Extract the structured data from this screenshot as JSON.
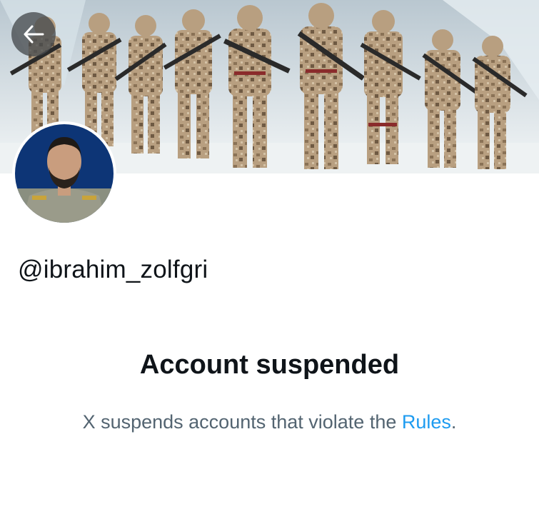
{
  "profile": {
    "handle": "@ibrahim_zolfgri"
  },
  "suspension": {
    "title": "Account suspended",
    "message_prefix": "X suspends accounts that violate the ",
    "rules_link": "Rules",
    "message_suffix": "."
  },
  "icons": {
    "back": "arrow-left-icon"
  },
  "colors": {
    "link": "#1d9bf0",
    "secondary_text": "#536471",
    "primary_text": "#0f1419"
  }
}
